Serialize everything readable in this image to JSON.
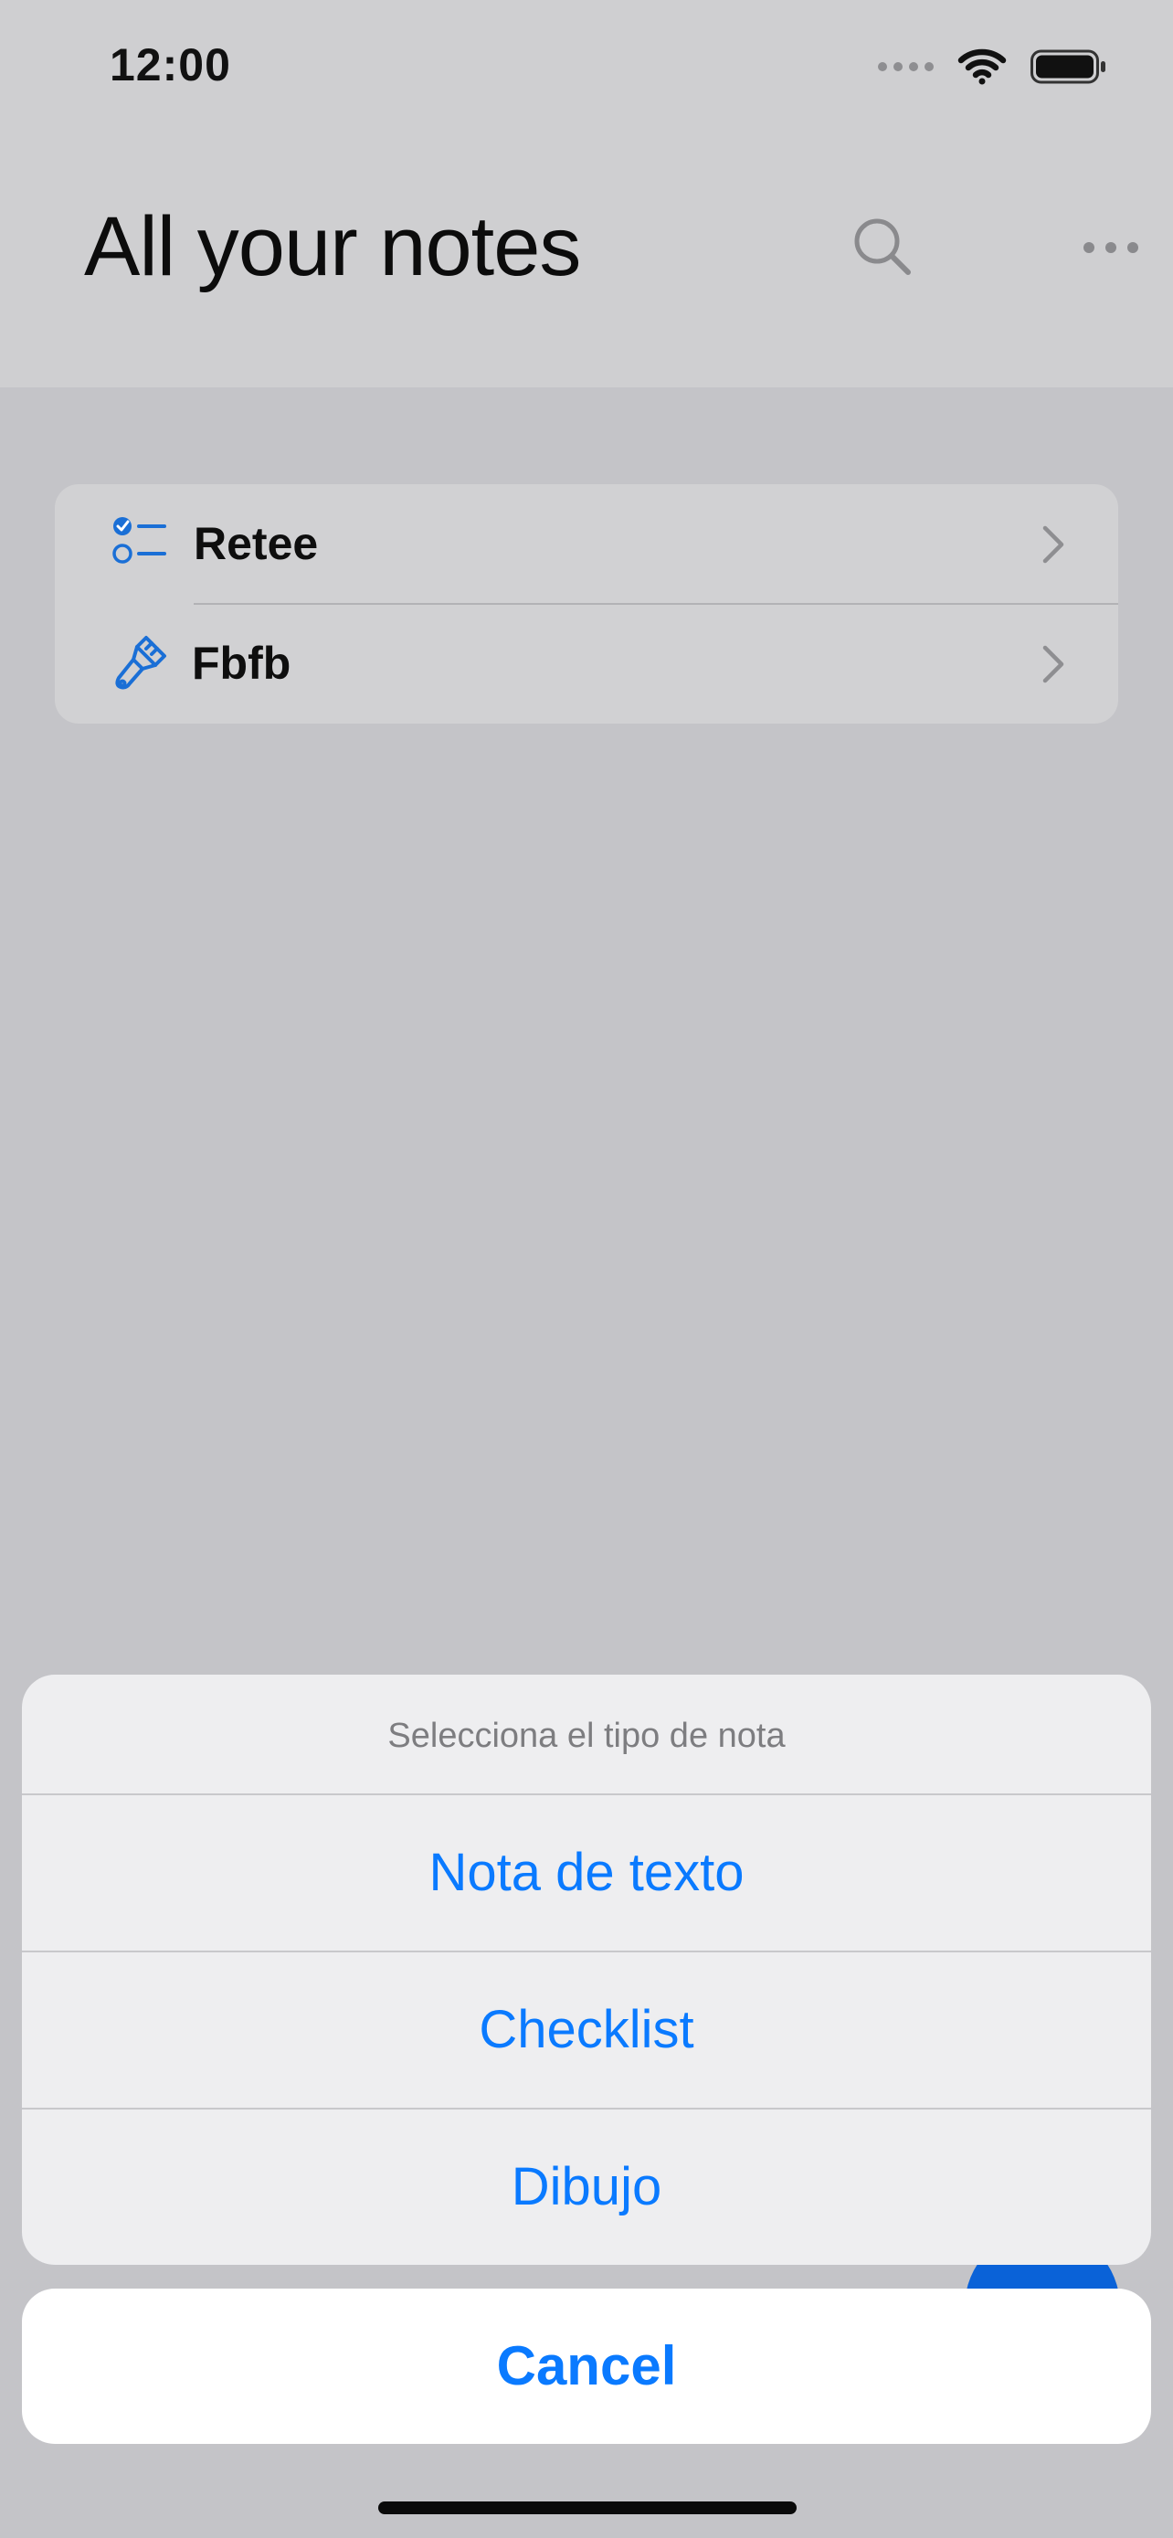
{
  "status_bar": {
    "time": "12:00",
    "signal_icon": "cellular-signal-icon",
    "wifi_icon": "wifi-icon",
    "battery_icon": "battery-icon"
  },
  "header": {
    "title": "All your notes",
    "search_icon": "search-icon",
    "more_icon": "ellipsis-icon"
  },
  "notes": [
    {
      "title": "Retee",
      "icon": "checklist-icon"
    },
    {
      "title": "Fbfb",
      "icon": "paintbrush-icon"
    }
  ],
  "action_sheet": {
    "title": "Selecciona el tipo de nota",
    "options": [
      "Nota de texto",
      "Checklist",
      "Dibujo"
    ],
    "cancel_label": "Cancel"
  },
  "colors": {
    "accent": "#0a7aff",
    "icon_blue": "#1a6fd6",
    "fab": "#0a62d8"
  }
}
